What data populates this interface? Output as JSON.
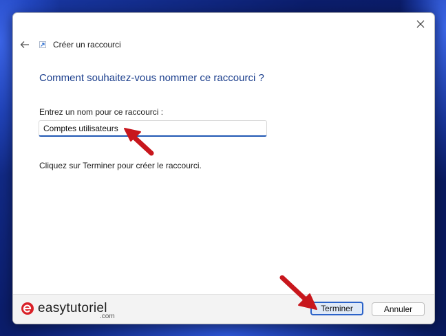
{
  "dialog": {
    "title": "Créer un raccourci",
    "heading": "Comment souhaitez-vous nommer ce raccourci ?",
    "name_label": "Entrez un nom pour ce raccourci :",
    "name_value": "Comptes utilisateurs",
    "hint": "Cliquez sur Terminer pour créer le raccourci."
  },
  "footer": {
    "finish_label": "Terminer",
    "cancel_label": "Annuler"
  },
  "watermark": {
    "brand": "easytutoriel",
    "suffix": ".com"
  },
  "icons": {
    "close": "close-icon",
    "back": "back-arrow-icon",
    "shortcut": "shortcut-arrow-icon",
    "annotation": "red-arrow-icon"
  },
  "colors": {
    "heading": "#1b3e8c",
    "accent": "#1f57b3",
    "annotation": "#c8171d"
  }
}
